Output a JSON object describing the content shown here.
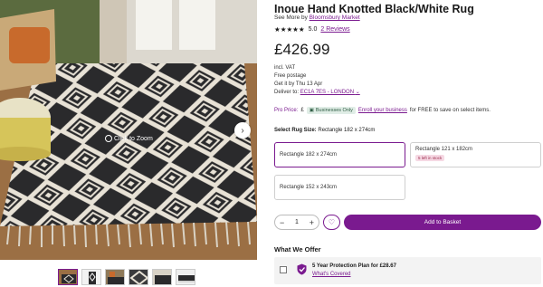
{
  "gallery": {
    "zoom_hint": "Click to Zoom",
    "icons": {
      "zoom": "magnify-icon",
      "next": "chevron-right-icon"
    },
    "thumbnail_count": 6
  },
  "product": {
    "title": "Inoue Hand Knotted Black/White Rug",
    "seller_prefix": "See More by",
    "seller_name": "Bloomsbury Market",
    "stars": "★★★★★",
    "rating": "5.0",
    "reviews": "2 Reviews",
    "price": "£426.99",
    "vat": "incl. VAT",
    "postage": "Free postage",
    "get_it": "Get it by Thu 13 Apr",
    "deliver_prefix": "Deliver to:",
    "deliver_location": "EC1A 7ES - LONDON",
    "pro_price_label": "Pro Price:",
    "pro_price_currency": "£",
    "pro_badge": "Businesses Only",
    "enroll_link": "Enroll your business",
    "enroll_suffix": "for FREE to save on select items."
  },
  "size": {
    "label": "Select Rug Size:",
    "selected": "Rectangle 182 x 274cm",
    "options": [
      {
        "label": "Rectangle 182 x 274cm",
        "badge": ""
      },
      {
        "label": "Rectangle 121 x 182cm",
        "badge": "5 left in stock"
      },
      {
        "label": "Rectangle 152 x 243cm",
        "badge": ""
      }
    ]
  },
  "cart": {
    "minus": "−",
    "quantity": "1",
    "plus": "+",
    "add_label": "Add to Basket"
  },
  "offer": {
    "heading": "What We Offer",
    "plan": "5 Year Protection Plan for £28.67",
    "link": "What's Covered"
  },
  "colors": {
    "accent": "#7a1a8f",
    "badge_bg": "#e0ede6",
    "stock_bg": "#f6d9e4"
  }
}
